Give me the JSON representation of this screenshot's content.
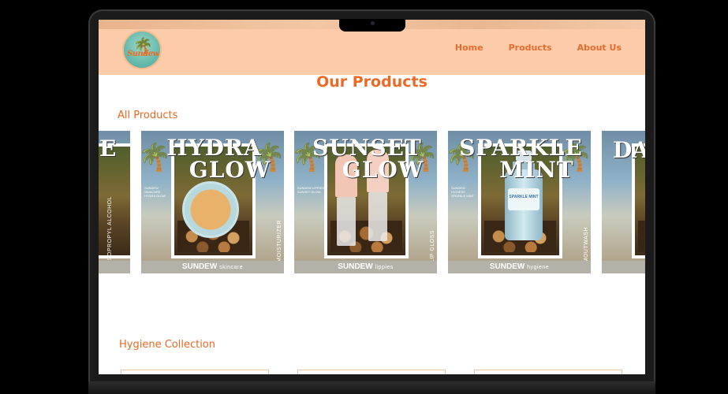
{
  "site": {
    "logo_text": "Sundew",
    "nav": [
      {
        "label": "Home"
      },
      {
        "label": "Products"
      },
      {
        "label": "About Us"
      }
    ]
  },
  "page": {
    "title": "Our Products",
    "all_products_heading": "All Products",
    "hygiene_heading": "Hygiene Collection"
  },
  "carousel": {
    "partial_left": {
      "title": "E",
      "side_label": "ISOPROPYL ALCOHOL"
    },
    "cards": [
      {
        "title_line1": "HYDRA",
        "title_line2": "GLOW",
        "side_label": "MOISTURIZER",
        "brand": "SUNDEW",
        "brand_sub": "skincare",
        "left_copy": "SUNDEW SKINCARE HYDRA GLOW"
      },
      {
        "title_line1": "SUNSET",
        "title_line2": "GLOW",
        "side_label": "LIP GLOSS",
        "brand": "SUNDEW",
        "brand_sub": "lippies",
        "left_copy": "SUNDEW LIPPIES SUNSET GLOW"
      },
      {
        "title_line1": "SPARKLE",
        "title_line2": "MINT",
        "side_label": "MOUTWASH",
        "brand": "SUNDEW",
        "brand_sub": "hygiene",
        "left_copy": "SUNDEW HYGIENE SPARKLE MINT",
        "bottle_label": "SPARKLE MINT"
      }
    ],
    "partial_right": {
      "title": "DA"
    }
  },
  "colors": {
    "accent": "#ee6a24",
    "nav_bg": "#fccbaa",
    "page_bg": "#ffffff"
  }
}
